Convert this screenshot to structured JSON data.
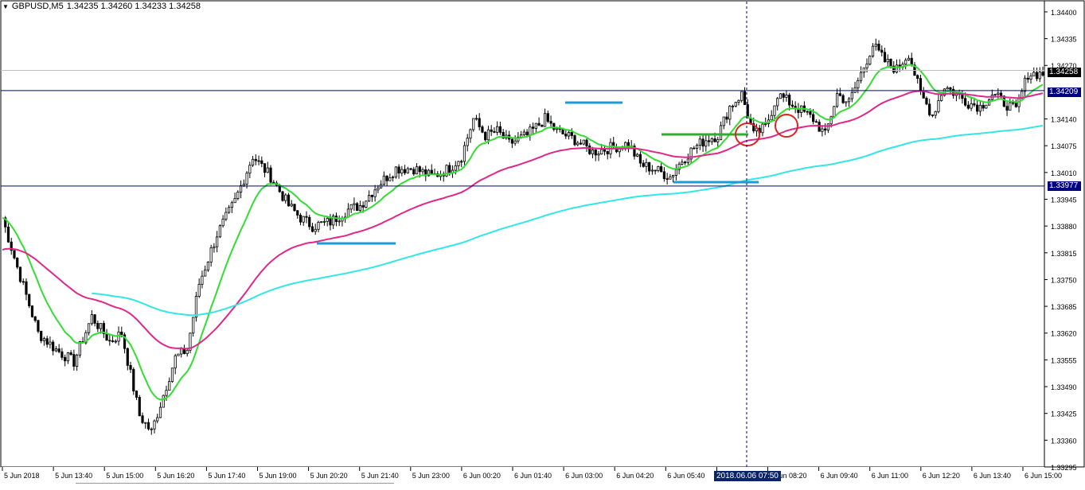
{
  "header": {
    "symbol": "GBPUSD,M5",
    "ohlc": "1.34235 1.34260 1.34233 1.34258"
  },
  "colors": {
    "background": "#ffffff",
    "candle": "#000000",
    "ma_fast": "#33dd33",
    "ma_mid": "#e0278a",
    "ma_slow": "#33e6e6",
    "hline": "#000080",
    "annotation_blue": "#1e9ad6",
    "annotation_green": "#33aa33",
    "annotation_circle": "#dd2222"
  },
  "price_labels": {
    "current": "1.34258",
    "line_upper": "1.34209",
    "line_lower": "1.33977"
  },
  "crosshair_time": "2018.06.06 07:50",
  "chart_data": {
    "type": "candlestick",
    "ylim": [
      1.33295,
      1.34425
    ],
    "y_ticks": [
      "1.34400",
      "1.34335",
      "1.34270",
      "1.34140",
      "1.34075",
      "1.34010",
      "1.33945",
      "1.33880",
      "1.33815",
      "1.33750",
      "1.33685",
      "1.33620",
      "1.33555",
      "1.33490",
      "1.33425",
      "1.33360",
      "1.33295"
    ],
    "x_ticks": [
      "5 Jun 2018",
      "5 Jun 13:40",
      "5 Jun 15:00",
      "5 Jun 16:20",
      "5 Jun 17:40",
      "5 Jun 19:00",
      "5 Jun 20:20",
      "5 Jun 21:40",
      "5 Jun 23:00",
      "6 Jun 00:20",
      "6 Jun 01:40",
      "6 Jun 03:00",
      "6 Jun 04:20",
      "6 Jun 05:40",
      "6 Jun 07:00",
      "6 Jun 08:20",
      "6 Jun 09:40",
      "6 Jun 11:00",
      "6 Jun 12:20",
      "6 Jun 13:40",
      "6 Jun 15:00"
    ],
    "price_keypoints": [
      [
        0,
        1.339
      ],
      [
        5,
        1.3378
      ],
      [
        12,
        1.3362
      ],
      [
        18,
        1.3358
      ],
      [
        24,
        1.3355
      ],
      [
        30,
        1.3366
      ],
      [
        36,
        1.336
      ],
      [
        40,
        1.3362
      ],
      [
        46,
        1.3342
      ],
      [
        50,
        1.3338
      ],
      [
        54,
        1.3347
      ],
      [
        58,
        1.3356
      ],
      [
        62,
        1.3358
      ],
      [
        66,
        1.3374
      ],
      [
        72,
        1.3386
      ],
      [
        78,
        1.3394
      ],
      [
        84,
        1.3405
      ],
      [
        90,
        1.34
      ],
      [
        96,
        1.3393
      ],
      [
        100,
        1.339
      ],
      [
        104,
        1.3388
      ],
      [
        110,
        1.3389
      ],
      [
        116,
        1.3392
      ],
      [
        120,
        1.3393
      ],
      [
        126,
        1.3398
      ],
      [
        132,
        1.3402
      ],
      [
        138,
        1.3402
      ],
      [
        144,
        1.34
      ],
      [
        150,
        1.3402
      ],
      [
        154,
        1.3405
      ],
      [
        158,
        1.3414
      ],
      [
        162,
        1.341
      ],
      [
        166,
        1.3411
      ],
      [
        170,
        1.3408
      ],
      [
        176,
        1.341
      ],
      [
        182,
        1.3414
      ],
      [
        186,
        1.3411
      ],
      [
        192,
        1.3409
      ],
      [
        198,
        1.3406
      ],
      [
        204,
        1.3407
      ],
      [
        210,
        1.3408
      ],
      [
        214,
        1.3403
      ],
      [
        218,
        1.3402
      ],
      [
        224,
        1.34
      ],
      [
        228,
        1.3404
      ],
      [
        232,
        1.3407
      ],
      [
        236,
        1.3409
      ],
      [
        240,
        1.341
      ],
      [
        244,
        1.3417
      ],
      [
        248,
        1.342
      ],
      [
        252,
        1.341
      ],
      [
        256,
        1.3412
      ],
      [
        260,
        1.342
      ],
      [
        264,
        1.3418
      ],
      [
        268,
        1.3416
      ],
      [
        272,
        1.3414
      ],
      [
        276,
        1.341
      ],
      [
        280,
        1.342
      ],
      [
        284,
        1.3418
      ],
      [
        288,
        1.3425
      ],
      [
        292,
        1.3432
      ],
      [
        296,
        1.3428
      ],
      [
        300,
        1.3426
      ],
      [
        304,
        1.343
      ],
      [
        308,
        1.342
      ],
      [
        312,
        1.3415
      ],
      [
        316,
        1.3422
      ],
      [
        320,
        1.342
      ],
      [
        324,
        1.3418
      ],
      [
        328,
        1.3417
      ],
      [
        332,
        1.342
      ],
      [
        336,
        1.3418
      ],
      [
        340,
        1.3416
      ],
      [
        344,
        1.3425
      ],
      [
        349,
        1.3425
      ]
    ]
  }
}
